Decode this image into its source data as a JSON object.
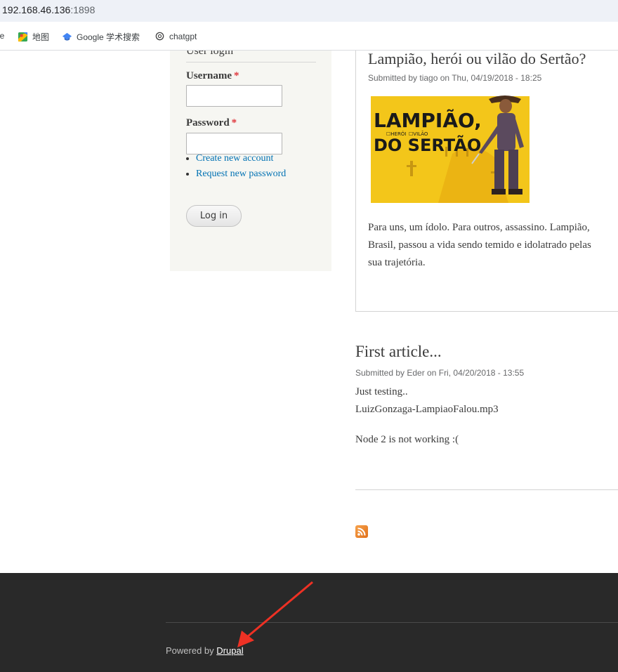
{
  "address_bar": {
    "host": "192.168.46.136",
    "port": ":1898"
  },
  "bookmarks": [
    {
      "label": "ое",
      "icon": "bookmark-icon"
    },
    {
      "label": "地图",
      "icon": "maps-icon"
    },
    {
      "label": "Google 学术搜索",
      "icon": "scholar-icon"
    },
    {
      "label": "chatgpt",
      "icon": "openai-icon"
    }
  ],
  "login_block": {
    "title": "User login",
    "username_label": "Username",
    "password_label": "Password",
    "required_mark": "*",
    "username_value": "",
    "password_value": "",
    "links": [
      "Create new account",
      "Request new password"
    ],
    "login_button": "Log in"
  },
  "nodes": [
    {
      "title": "Lampião, herói ou vilão do Sertão?",
      "submitted": "Submitted by tiago on Thu, 04/19/2018 - 18:25",
      "image": {
        "line1": "LAMPIÃO,",
        "opt1": "☐HERÓI",
        "opt2": "☐VILÃO",
        "line2": "DO SERTÃO"
      },
      "body_lines": [
        "Para uns, um ídolo. Para outros, assassino. Lampião,",
        "Brasil, passou a vida sendo temido e idolatrado pelas",
        "sua trajetória."
      ]
    },
    {
      "title": "First article...",
      "submitted": "Submitted by Eder on Fri, 04/20/2018 - 13:55",
      "body_lines": [
        "Just testing..",
        "LuizGonzaga-LampiaoFalou.mp3",
        "Node 2 is not working :("
      ]
    }
  ],
  "footer": {
    "powered_by": "Powered by",
    "link": "Drupal"
  },
  "colors": {
    "link": "#0071b3",
    "required": "#e0383e",
    "footer_bg": "#292929",
    "arrow": "#ee3124"
  }
}
